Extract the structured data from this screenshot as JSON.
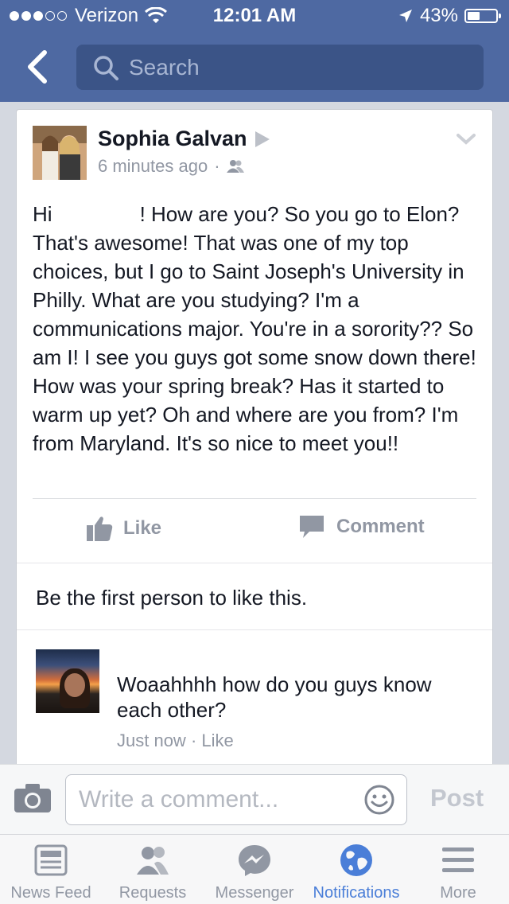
{
  "status_bar": {
    "carrier": "Verizon",
    "time": "12:01 AM",
    "battery": "43%",
    "battery_level": 0.43
  },
  "header": {
    "search_placeholder": "Search"
  },
  "post": {
    "author": "Sophia Galvan",
    "timestamp": "6 minutes ago",
    "text_greeting": "Hi",
    "text_body": "! How are you? So you go to Elon? That's awesome! That was one of my top choices, but I go to Saint Joseph's University in Philly. What are you studying? I'm a communications major. You're in a sorority?? So am I! I see you guys got some snow down there! How was your spring break? Has it started to warm up yet? Oh and where are you from? I'm from Maryland. It's so nice to meet you!!",
    "actions": {
      "like": "Like",
      "comment": "Comment"
    },
    "likes_summary": "Be the first person to like this."
  },
  "comment": {
    "text": "Woaahhhh how do you guys know each other?",
    "time": "Just now",
    "like": "Like"
  },
  "composer": {
    "placeholder": "Write a comment...",
    "post_label": "Post"
  },
  "tabs": [
    {
      "label": "News Feed",
      "icon": "news-feed-icon"
    },
    {
      "label": "Requests",
      "icon": "friend-requests-icon"
    },
    {
      "label": "Messenger",
      "icon": "messenger-icon"
    },
    {
      "label": "Notifications",
      "icon": "globe-icon",
      "active": true
    },
    {
      "label": "More",
      "icon": "hamburger-icon"
    }
  ],
  "colors": {
    "header_bg": "#4e69a2",
    "search_bg": "#3b5487",
    "active_tab": "#4a7ed8",
    "muted_text": "#9197a3"
  }
}
